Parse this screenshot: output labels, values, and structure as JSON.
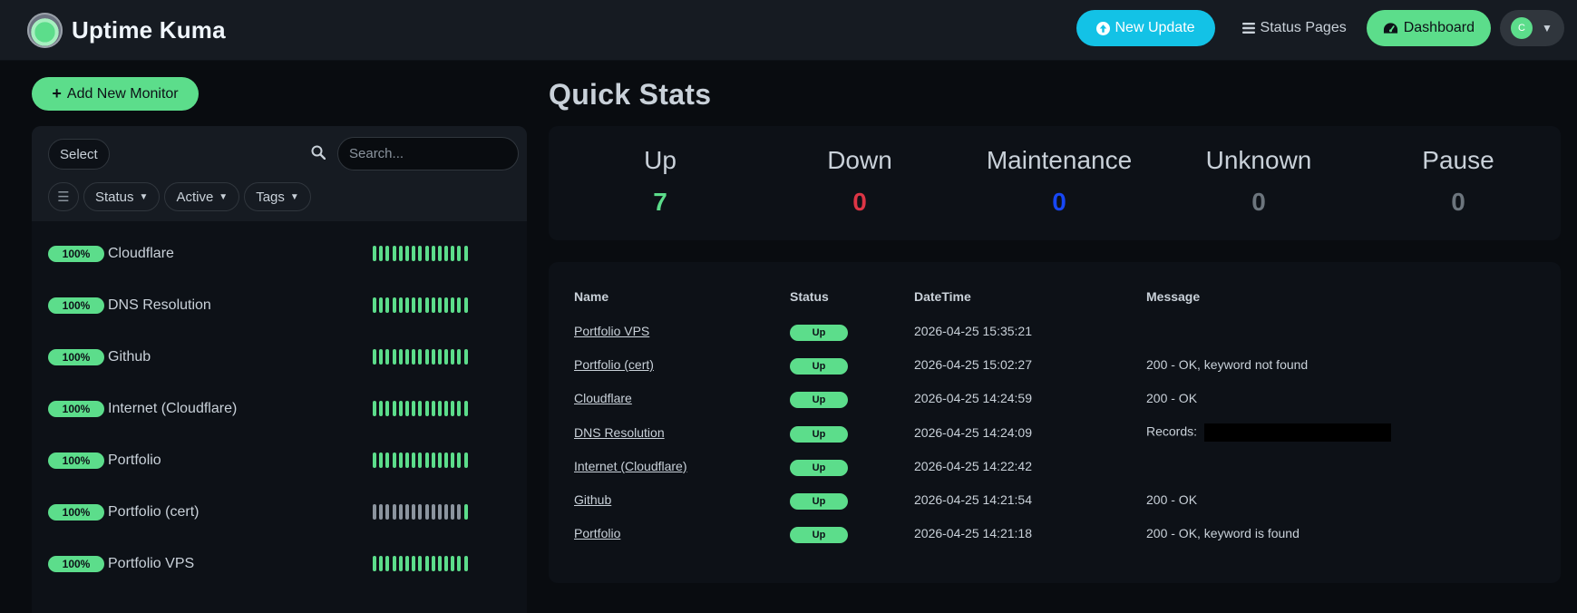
{
  "header": {
    "brand": "Uptime Kuma",
    "new_update": "New Update",
    "status_pages": "Status Pages",
    "dashboard": "Dashboard",
    "avatar_initial": "C"
  },
  "sidebar": {
    "add_monitor": "Add New Monitor",
    "select": "Select",
    "search_placeholder": "Search...",
    "filters": {
      "status": "Status",
      "active": "Active",
      "tags": "Tags"
    },
    "monitors": [
      {
        "percent": "100%",
        "name": "Cloudflare",
        "beats": "ggggggggggggggg"
      },
      {
        "percent": "100%",
        "name": "DNS Resolution",
        "beats": "ggggggggggggggg"
      },
      {
        "percent": "100%",
        "name": "Github",
        "beats": "ggggggggggggggg"
      },
      {
        "percent": "100%",
        "name": "Internet (Cloudflare)",
        "beats": "ggggggggggggggg"
      },
      {
        "percent": "100%",
        "name": "Portfolio",
        "beats": "ggggggggggggggg"
      },
      {
        "percent": "100%",
        "name": "Portfolio (cert)",
        "beats": "yyyyyyyyyyyyyyg"
      },
      {
        "percent": "100%",
        "name": "Portfolio VPS",
        "beats": "ggggggggggggggg"
      }
    ]
  },
  "quick_stats": {
    "title": "Quick Stats",
    "items": [
      {
        "label": "Up",
        "value": "7",
        "color": "#5cdd8b"
      },
      {
        "label": "Down",
        "value": "0",
        "color": "#dc3545"
      },
      {
        "label": "Maintenance",
        "value": "0",
        "color": "#1747f5"
      },
      {
        "label": "Unknown",
        "value": "0",
        "color": "#6c757d"
      },
      {
        "label": "Pause",
        "value": "0",
        "color": "#6c757d"
      }
    ]
  },
  "events": {
    "columns": [
      "Name",
      "Status",
      "DateTime",
      "Message"
    ],
    "rows": [
      {
        "name": "Portfolio VPS",
        "status": "Up",
        "datetime": "2026-04-25 15:35:21",
        "message": ""
      },
      {
        "name": "Portfolio (cert)",
        "status": "Up",
        "datetime": "2026-04-25 15:02:27",
        "message": "200 - OK, keyword not found"
      },
      {
        "name": "Cloudflare",
        "status": "Up",
        "datetime": "2026-04-25 14:24:59",
        "message": "200 - OK"
      },
      {
        "name": "DNS Resolution",
        "status": "Up",
        "datetime": "2026-04-25 14:24:09",
        "message": "Records:"
      },
      {
        "name": "Internet (Cloudflare)",
        "status": "Up",
        "datetime": "2026-04-25 14:22:42",
        "message": ""
      },
      {
        "name": "Github",
        "status": "Up",
        "datetime": "2026-04-25 14:21:54",
        "message": "200 - OK"
      },
      {
        "name": "Portfolio",
        "status": "Up",
        "datetime": "2026-04-25 14:21:18",
        "message": "200 - OK, keyword is found"
      }
    ]
  }
}
